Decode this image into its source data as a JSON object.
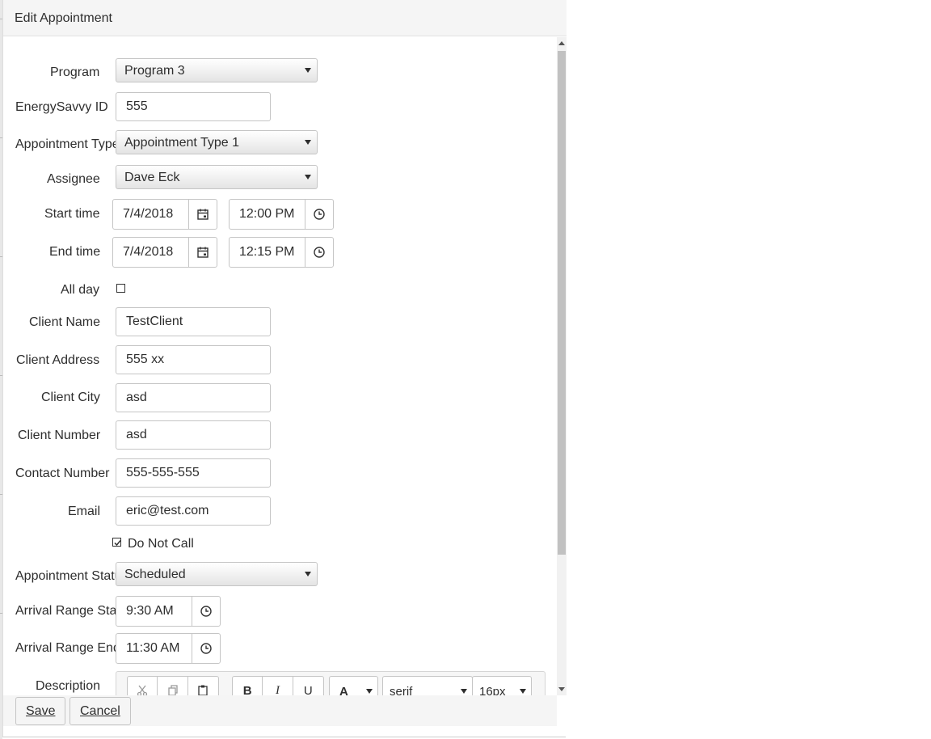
{
  "dialog": {
    "title": "Edit Appointment"
  },
  "form": {
    "program": {
      "label": "Program",
      "value": "Program 3"
    },
    "energysavvy_id": {
      "label": "EnergySavvy ID",
      "value": "555"
    },
    "appointment_type": {
      "label": "Appointment Type",
      "value": "Appointment Type 1"
    },
    "assignee": {
      "label": "Assignee",
      "value": "Dave Eck"
    },
    "start_time": {
      "label": "Start time",
      "date": "7/4/2018",
      "time": "12:00 PM"
    },
    "end_time": {
      "label": "End time",
      "date": "7/4/2018",
      "time": "12:15 PM"
    },
    "all_day": {
      "label": "All day",
      "checked": false
    },
    "client_name": {
      "label": "Client Name",
      "value": "TestClient"
    },
    "client_address": {
      "label": "Client Address",
      "value": "555 xx"
    },
    "client_city": {
      "label": "Client City",
      "value": "asd"
    },
    "client_number": {
      "label": "Client Number",
      "value": "asd"
    },
    "contact_number": {
      "label": "Contact Number",
      "value": "555-555-555"
    },
    "email": {
      "label": "Email",
      "value": "eric@test.com"
    },
    "do_not_call": {
      "label": "Do Not Call",
      "checked": true
    },
    "appointment_status": {
      "label": "Appointment Status",
      "value": "Scheduled"
    },
    "arrival_range_start": {
      "label": "Arrival Range Start",
      "value": "9:30 AM"
    },
    "arrival_range_end": {
      "label": "Arrival Range End",
      "value": "11:30 AM"
    },
    "description": {
      "label": "Description"
    }
  },
  "editor_toolbar": {
    "bold": "B",
    "italic": "I",
    "underline": "U",
    "font_color": "A",
    "font_family": "serif",
    "font_size": "16px"
  },
  "footer": {
    "save_label": "Save",
    "cancel_label": "Cancel"
  },
  "icons": {
    "calendar": "calendar-icon",
    "clock": "clock-icon",
    "cut": "cut-icon",
    "copy": "copy-icon",
    "paste": "paste-icon",
    "check": "check-icon"
  }
}
